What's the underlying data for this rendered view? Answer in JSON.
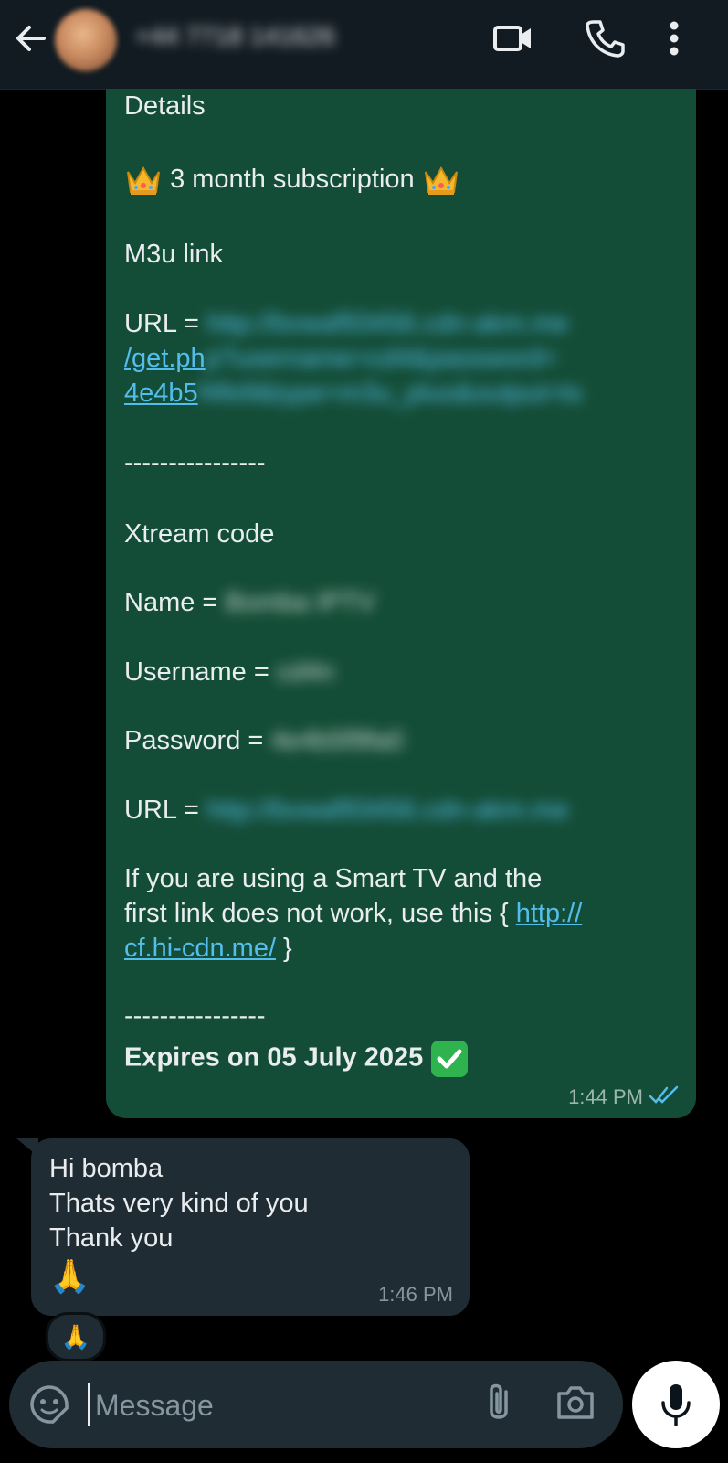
{
  "header": {
    "contact_name": "+44 7718 141626"
  },
  "message_out": {
    "lines": {
      "details": "Details",
      "subscription": "3 month subscription",
      "m3u": "M3u link",
      "url_label": "URL = ",
      "url_line1_hidden": "http://bvwaf93456.cdn-akm.me",
      "url_line2_visible": "/get.ph",
      "url_line2_hidden": "p?username=cd4&password=",
      "url_line3_visible": "4e4b5",
      "url_line3_hidden": "f4fe9&type=m3u_plus&output=ts",
      "divider1": "----------------",
      "xtream": "Xtream code",
      "name_label": "Name = ",
      "name_hidden": "Bomba IPTV",
      "username_label": "Username = ",
      "username_hidden": "cd4n",
      "password_label": "Password = ",
      "password_hidden": "4e4b5f9fa0",
      "url2_label": "URL = ",
      "url2_hidden": "http://bvwaf93456.cdn-akm.me",
      "smart_tv_1": "If you are using a Smart TV and the",
      "smart_tv_2_prefix": "first link does not work, use this { ",
      "smart_tv_link_1": "http://",
      "smart_tv_link_2": "cf.hi-cdn.me/",
      "smart_tv_suffix": " }",
      "divider2": "----------------",
      "expires": "Expires on 05 July 2025"
    },
    "time": "1:44 PM",
    "status": "read"
  },
  "message_in": {
    "line1": "Hi bomba",
    "line2": "Thats very kind of you",
    "line3": "Thank you",
    "emoji": "🙏",
    "time": "1:46 PM",
    "reaction": "🙏"
  },
  "composer": {
    "placeholder": "Message"
  },
  "colors": {
    "outgoing_bubble": "#144d37",
    "incoming_bubble": "#202c33",
    "link": "#53bdeb",
    "header": "#121b22"
  },
  "icons": [
    "back-arrow-icon",
    "video-call-icon",
    "phone-icon",
    "more-vert-icon",
    "crown-icon",
    "check-mark-icon",
    "double-tick-icon",
    "sticker-icon",
    "attach-icon",
    "camera-icon",
    "mic-icon",
    "folded-hands-icon"
  ]
}
